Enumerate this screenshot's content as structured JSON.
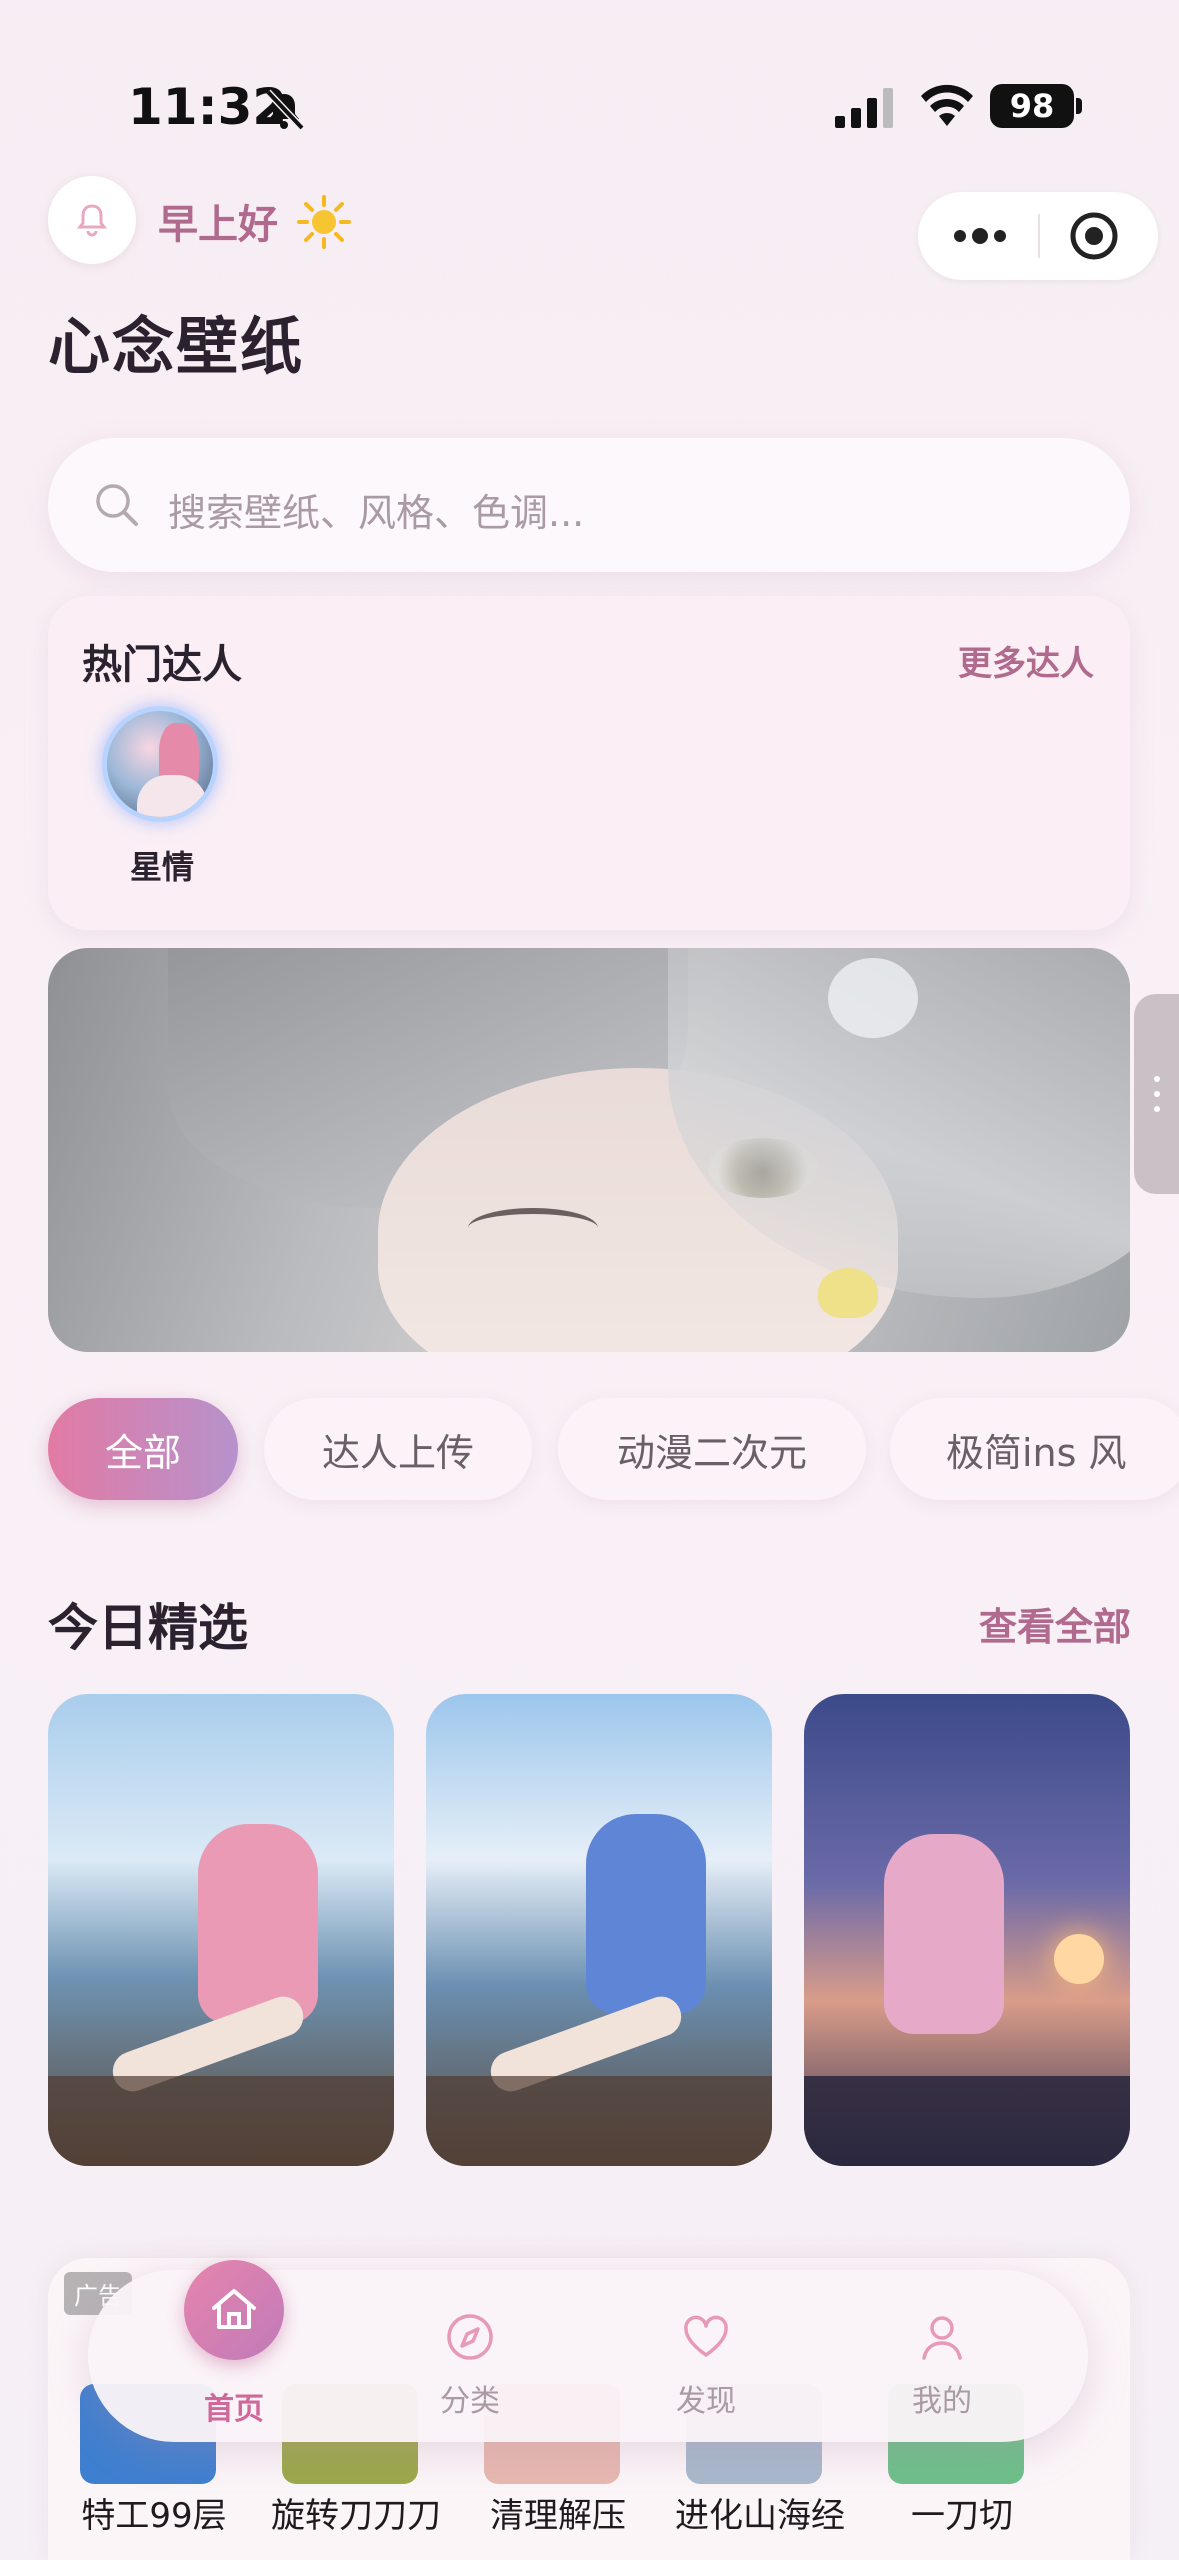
{
  "status_bar": {
    "time": "11:32",
    "battery": "98"
  },
  "header": {
    "greeting": "早上好",
    "title": "心念壁纸"
  },
  "search": {
    "placeholder": "搜索壁纸、风格、色调..."
  },
  "creators": {
    "title": "热门达人",
    "more": "更多达人",
    "items": [
      {
        "name": "星情"
      }
    ]
  },
  "tabs": [
    "全部",
    "达人上传",
    "动漫二次元",
    "极简ins 风"
  ],
  "today": {
    "title": "今日精选",
    "view_all": "查看全部"
  },
  "ad": {
    "tag": "广告",
    "games": [
      "特工99层",
      "旋转刀刀刀",
      "清理解压",
      "进化山海经",
      "一刀切"
    ]
  },
  "nav": {
    "items": [
      {
        "label": "首页",
        "icon": "home-icon"
      },
      {
        "label": "分类",
        "icon": "compass-icon"
      },
      {
        "label": "发现",
        "icon": "heart-icon"
      },
      {
        "label": "我的",
        "icon": "user-icon"
      }
    ],
    "active_index": 0
  },
  "colors": {
    "accent": "#b06a8e",
    "active_tab_start": "#e27aa4",
    "active_tab_end": "#b692cc"
  }
}
